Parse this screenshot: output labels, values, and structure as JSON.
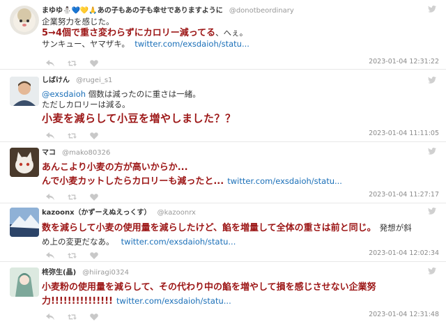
{
  "tweets": [
    {
      "name": "まゆゆ",
      "name_emoji": "⛄💙💛🙏あの子もあの子も幸せでありますように",
      "handle": "@donotbeordinary",
      "line1": "企業努力を感じた。",
      "line2_bold": "5→4個で重さ変わらずにカロリー減ってる",
      "line2_tail": "、へぇ。",
      "line3": "サンキュー、ヤマザキ。",
      "link": "twitter.com/exsdaioh/statu...",
      "timestamp": "2023-01-04 12:31:22"
    },
    {
      "name": "しばけん",
      "handle": "@rugei_s1",
      "mention": "@exsdaioh",
      "line1_tail": " 個数は減ったのに重さは一緒。",
      "line2": "ただしカロリーは減る。",
      "line3_bold": "小麦を減らして小豆を増やしました？？",
      "timestamp": "2023-01-04 11:11:05"
    },
    {
      "name": "マコ",
      "handle": "@mako80326",
      "line1_bold": "あんこより小麦の方が高いからか...",
      "line2_bold": "んで小麦カットしたらカロリーも減ったと...",
      "link": "twitter.com/exsdaioh/statu...",
      "timestamp": "2023-01-04 11:27:17"
    },
    {
      "name": "kazoonx（かずーえぬえっくす）",
      "handle": "@kazoonrx",
      "line1_bold": "数を減らして小麦の使用量を減らしたけど、餡を増量して全体の重さは前と同じ。",
      "line1_tail": "発想が斜",
      "line2": "め上の変更だなあ。",
      "link": "twitter.com/exsdaioh/statu...",
      "timestamp": "2023-01-04 12:02:34"
    },
    {
      "name": "柊弥生(晶)",
      "handle": "@hiiragi0324",
      "line1_bold": "小麦粉の使用量を減らして、その代わり中の餡を増やして損を感じさせない企業努",
      "line2_bold": "力!!!!!!!!!!!!!!!",
      "link": "twitter.com/exsdaioh/statu...",
      "timestamp": "2023-01-04 12:31:48"
    }
  ],
  "icons": {
    "reply": "reply-icon",
    "retweet": "retweet-icon",
    "like": "heart-icon",
    "brand": "twitter-bird-icon"
  },
  "colors": {
    "emphasis": "#9c1616",
    "link": "#1a6fb8",
    "meta": "#999999",
    "action": "#c8c8c8"
  }
}
